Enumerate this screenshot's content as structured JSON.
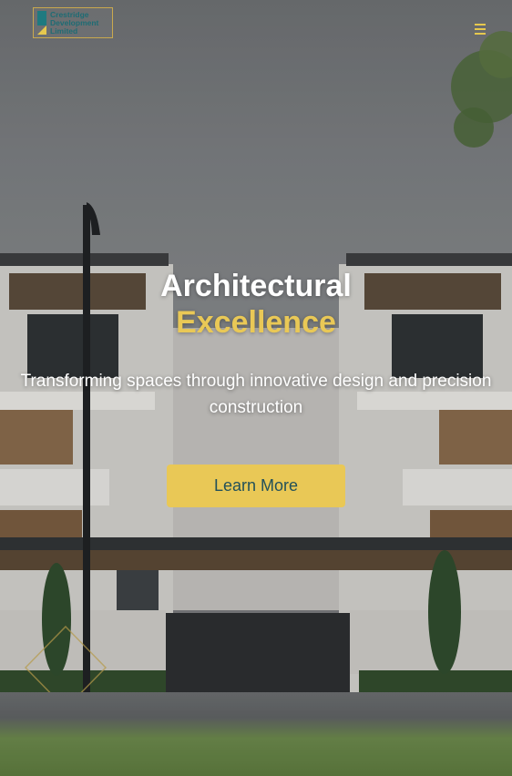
{
  "header": {
    "logo_lines": [
      "Crestridge",
      "Development",
      "Limited"
    ],
    "menu_icon": "hamburger-menu-icon"
  },
  "hero": {
    "title_line1": "Architectural",
    "title_line2": "Excellence",
    "subtitle": "Transforming spaces through innovative design and precision construction",
    "cta_label": "Learn More"
  },
  "colors": {
    "accent": "#e9c856",
    "brand_teal": "#1f7a80",
    "cta_text": "#23515a"
  }
}
